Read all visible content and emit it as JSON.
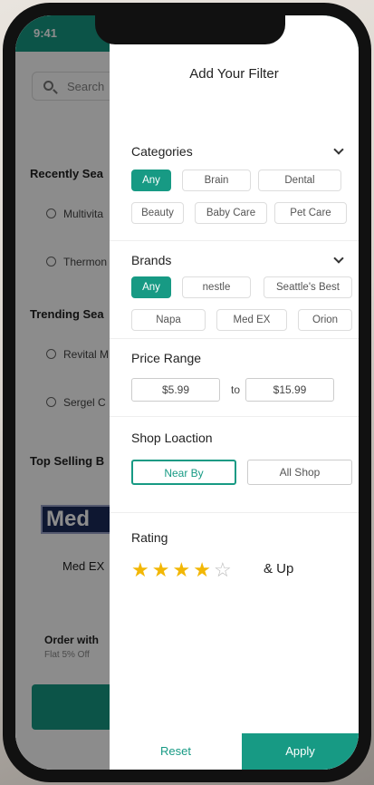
{
  "status": {
    "time": "9:41"
  },
  "background": {
    "search_placeholder": "Search",
    "recent_title": "Recently Sea",
    "recent_items": [
      "Multivita",
      "Thermon"
    ],
    "trending_title": "Trending Sea",
    "trending_items": [
      "Revital M",
      "Sergel C"
    ],
    "top_selling_title": "Top Selling B",
    "logo_text": "Med",
    "logo_label": "Med EX",
    "order_title": "Order with",
    "order_sub": "Flat 5% Off"
  },
  "filter": {
    "title": "Add Your Filter",
    "categories": {
      "title": "Categories",
      "chips": [
        "Any",
        "Brain",
        "Dental",
        "Beauty",
        "Baby Care",
        "Pet Care"
      ],
      "selected": "Any"
    },
    "brands": {
      "title": "Brands",
      "chips": [
        "Any",
        "nestle",
        "Seattle's Best",
        "Napa",
        "Med EX",
        "Orion"
      ],
      "selected": "Any"
    },
    "price": {
      "title": "Price Range",
      "min": "$5.99",
      "to_label": "to",
      "max": "$15.99"
    },
    "shop_location": {
      "title": "Shop Loaction",
      "options": [
        "Near By",
        "All Shop"
      ],
      "selected": "Near By"
    },
    "rating": {
      "title": "Rating",
      "value": 4,
      "max": 5,
      "suffix": "& Up"
    },
    "reset_label": "Reset",
    "apply_label": "Apply"
  },
  "colors": {
    "accent": "#179a84",
    "star": "#f2b705"
  }
}
